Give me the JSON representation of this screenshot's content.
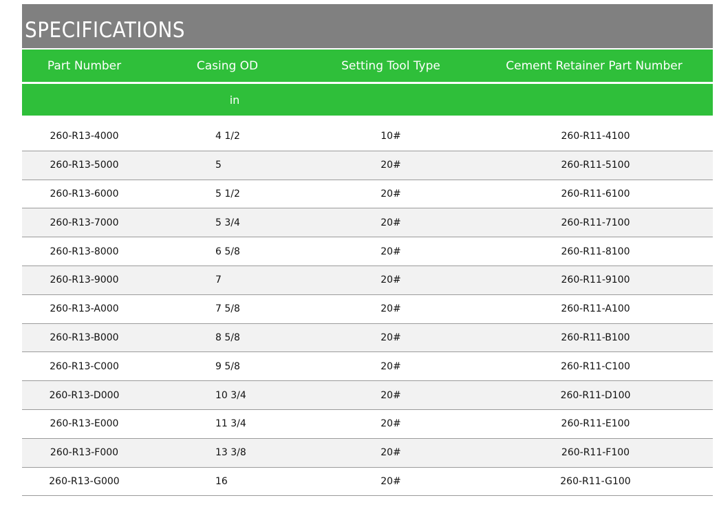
{
  "title": "SPECIFICATIONS",
  "headers": {
    "part_number": "Part Number",
    "casing_od": "Casing OD",
    "setting_tool_type": "Setting Tool Type",
    "cement_retainer_part_number": "Cement Retainer Part Number",
    "casing_od_unit": "in"
  },
  "rows": [
    {
      "part": "260-R13-4000",
      "casing": "4 1/2",
      "tool": "10#",
      "retainer": "260-R11-4100"
    },
    {
      "part": "260-R13-5000",
      "casing": "5",
      "tool": "20#",
      "retainer": "260-R11-5100"
    },
    {
      "part": "260-R13-6000",
      "casing": "5 1/2",
      "tool": "20#",
      "retainer": "260-R11-6100"
    },
    {
      "part": "260-R13-7000",
      "casing": "5 3/4",
      "tool": "20#",
      "retainer": "260-R11-7100"
    },
    {
      "part": "260-R13-8000",
      "casing": "6 5/8",
      "tool": "20#",
      "retainer": "260-R11-8100"
    },
    {
      "part": "260-R13-9000",
      "casing": "7",
      "tool": "20#",
      "retainer": "260-R11-9100"
    },
    {
      "part": "260-R13-A000",
      "casing": "7 5/8",
      "tool": "20#",
      "retainer": "260-R11-A100"
    },
    {
      "part": "260-R13-B000",
      "casing": "8 5/8",
      "tool": "20#",
      "retainer": "260-R11-B100"
    },
    {
      "part": "260-R13-C000",
      "casing": "9 5/8",
      "tool": "20#",
      "retainer": "260-R11-C100"
    },
    {
      "part": "260-R13-D000",
      "casing": "10 3/4",
      "tool": "20#",
      "retainer": "260-R11-D100"
    },
    {
      "part": "260-R13-E000",
      "casing": "11 3/4",
      "tool": "20#",
      "retainer": "260-R11-E100"
    },
    {
      "part": "260-R13-F000",
      "casing": "13 3/8",
      "tool": "20#",
      "retainer": "260-R11-F100"
    },
    {
      "part": "260-R13-G000",
      "casing": "16",
      "tool": "20#",
      "retainer": "260-R11-G100"
    }
  ],
  "colors": {
    "title_bar": "#808080",
    "header_green": "#2fbf3a",
    "row_alt": "#f2f2f2"
  }
}
